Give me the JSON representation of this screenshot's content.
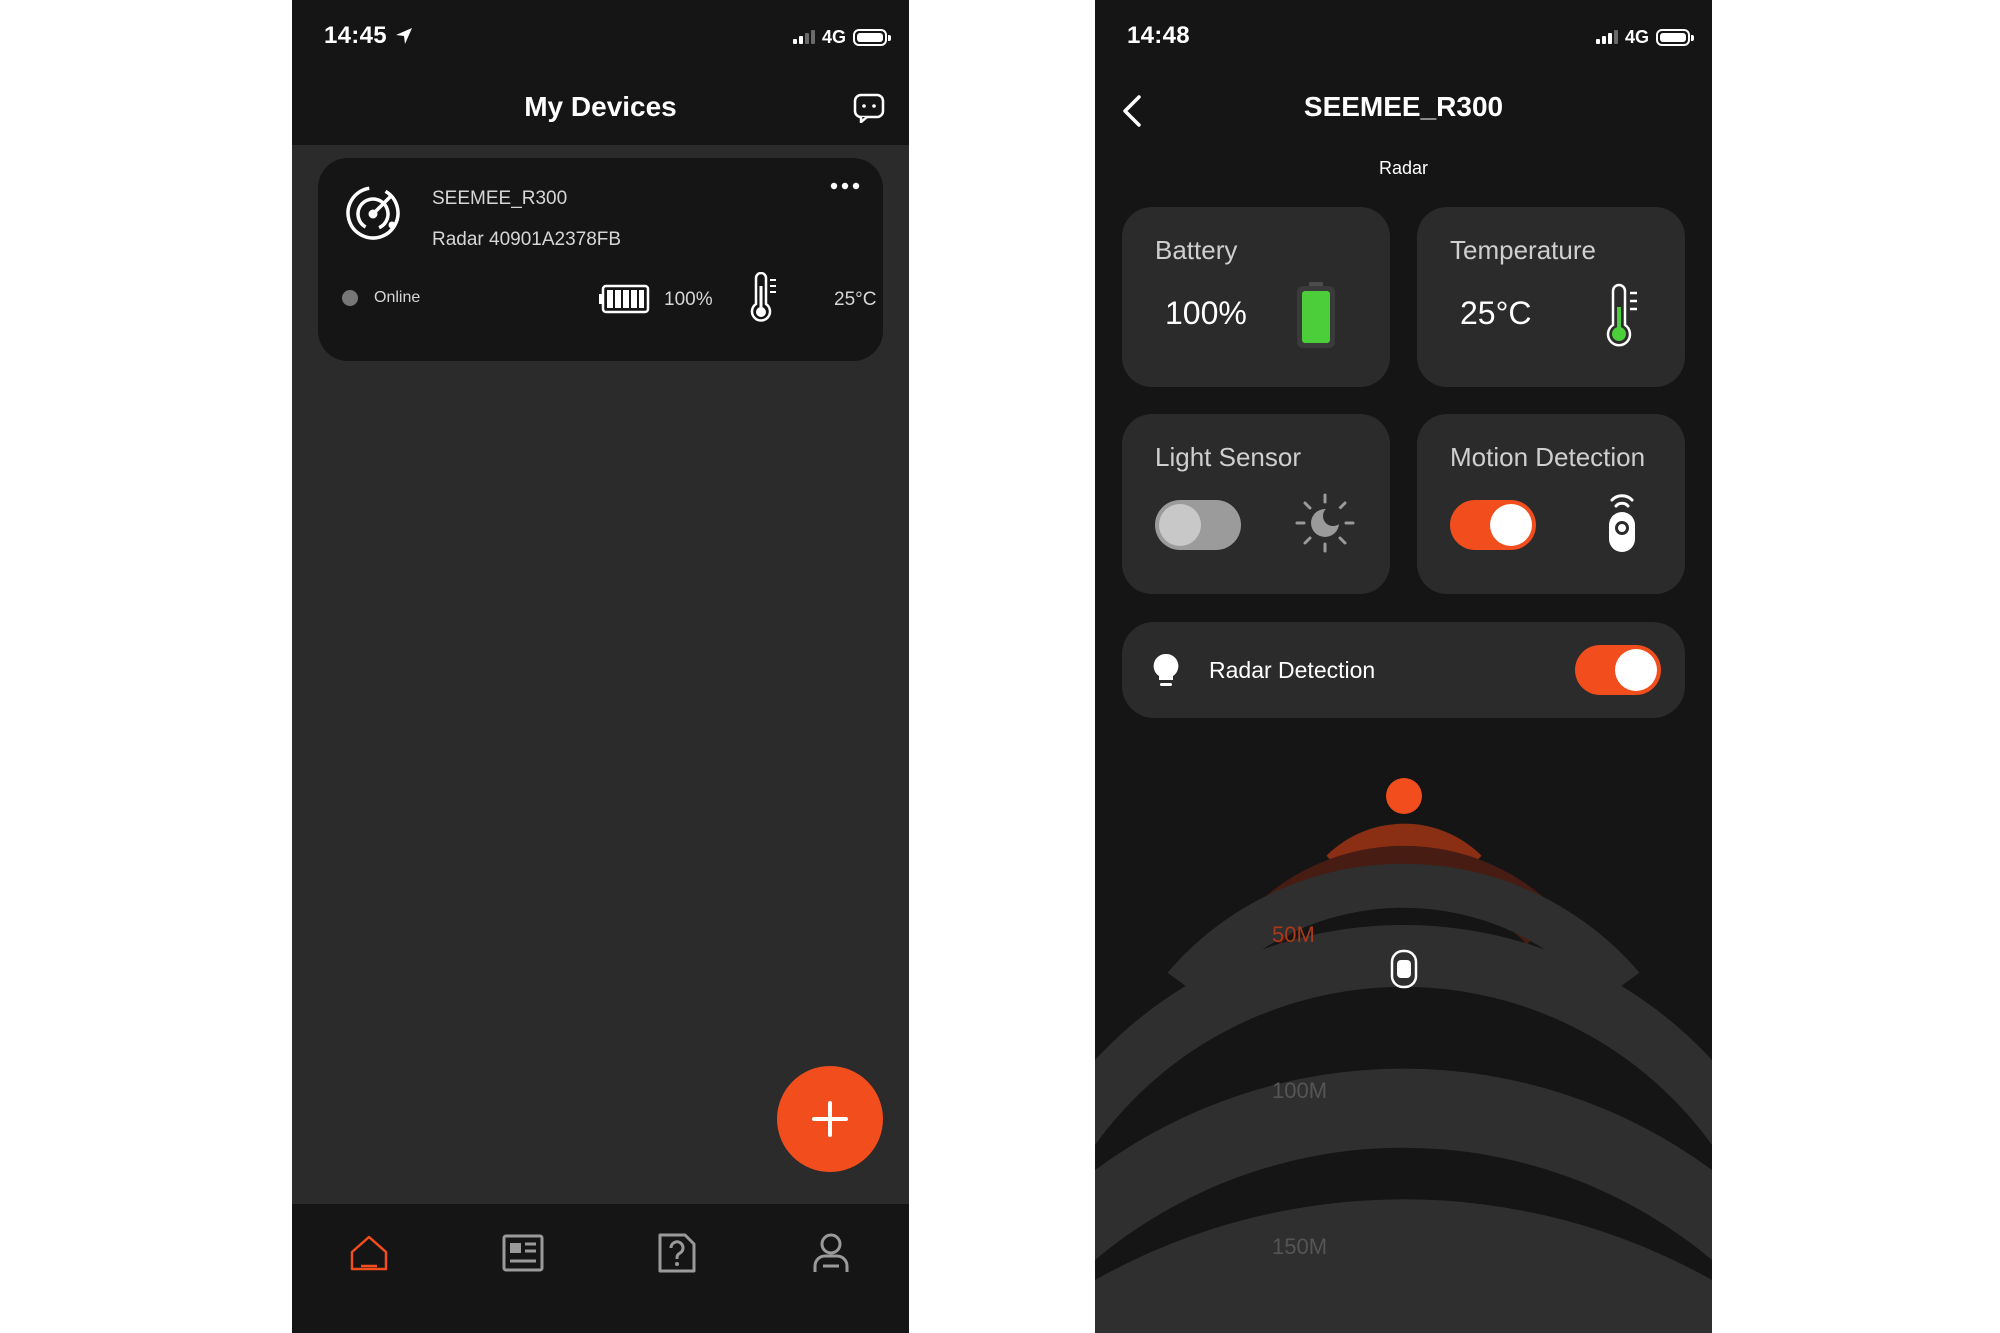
{
  "left": {
    "status": {
      "time": "14:45",
      "network": "4G"
    },
    "header": {
      "title": "My Devices"
    },
    "device": {
      "name": "SEEMEE_R300",
      "subtitle": "Radar 40901A2378FB",
      "status": "Online",
      "battery": "100%",
      "temperature": "25°C"
    },
    "tabs": [
      "home-icon",
      "news-icon",
      "help-icon",
      "profile-icon"
    ]
  },
  "right": {
    "status": {
      "time": "14:48",
      "network": "4G"
    },
    "header": {
      "title": "SEEMEE_R300",
      "subtitle": "Radar"
    },
    "tiles": {
      "battery": {
        "label": "Battery",
        "value": "100%",
        "level": 1.0
      },
      "temperature": {
        "label": "Temperature",
        "value": "25°C"
      },
      "light_sensor": {
        "label": "Light Sensor",
        "enabled": false
      },
      "motion_detection": {
        "label": "Motion Detection",
        "enabled": true
      }
    },
    "radar_detection": {
      "label": "Radar Detection",
      "enabled": true
    },
    "radar": {
      "ranges": [
        "50M",
        "100M",
        "150M"
      ]
    }
  },
  "colors": {
    "accent": "#f24d1d",
    "battery_green": "#4ccd3a",
    "card_dark": "#151515",
    "card_grey": "#2b2b2b"
  }
}
